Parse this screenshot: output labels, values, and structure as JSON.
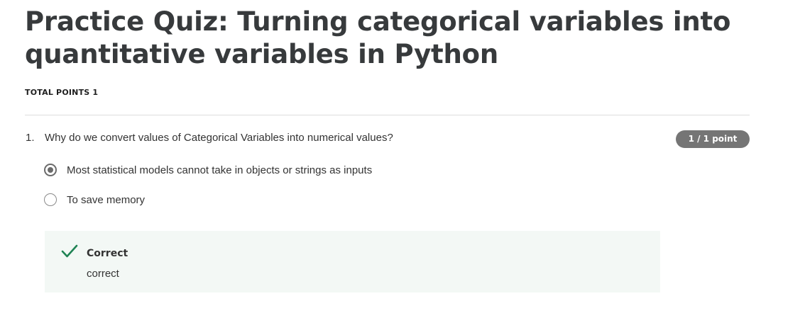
{
  "quiz": {
    "title": "Practice Quiz: Turning categorical variables into quantitative variables in Python",
    "total_points": "TOTAL POINTS 1"
  },
  "question": {
    "number": "1.",
    "text": "Why do we convert values of Categorical Variables into numerical values?",
    "points_badge": "1 / 1 point",
    "options": [
      {
        "label": "Most statistical models cannot take in objects or strings as inputs",
        "selected": true
      },
      {
        "label": "To save memory",
        "selected": false
      }
    ],
    "feedback": {
      "icon": "check-icon",
      "title": "Correct",
      "text": "correct",
      "accent_color": "#1f8354",
      "background": "#f3f8f5"
    }
  }
}
